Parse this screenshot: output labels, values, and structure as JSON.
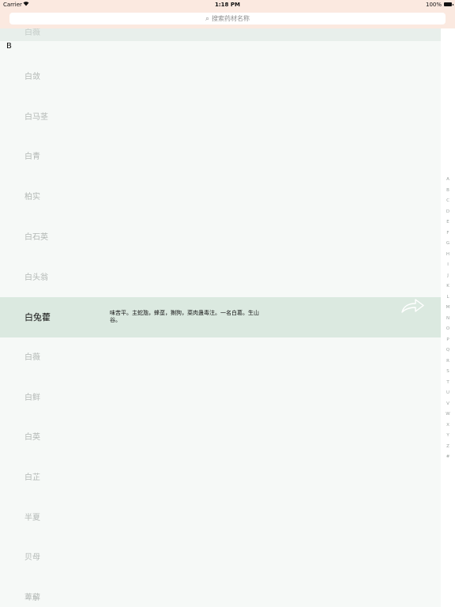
{
  "status_bar": {
    "carrier": "Carrier",
    "time": "1:18 PM",
    "battery": "100%"
  },
  "search": {
    "placeholder": "搜索药材名称"
  },
  "list": {
    "partial_top_item": "白薇",
    "section_header": "B",
    "items": [
      {
        "name": "白敛"
      },
      {
        "name": "白马茎"
      },
      {
        "name": "白青"
      },
      {
        "name": "柏实"
      },
      {
        "name": "白石英"
      },
      {
        "name": "白头翁"
      },
      {
        "name": "白兔藿",
        "selected": true,
        "description": "味苦平。主蛇虺，蜂虿，猘狗，菜肉蛊毒注。一名白葛。生山谷。"
      },
      {
        "name": "白薇"
      },
      {
        "name": "白鲜"
      },
      {
        "name": "白英"
      },
      {
        "name": "白芷"
      },
      {
        "name": "半夏"
      },
      {
        "name": "贝母"
      },
      {
        "name": "萆薢"
      }
    ]
  },
  "index_bar": [
    "A",
    "B",
    "C",
    "D",
    "E",
    "F",
    "G",
    "H",
    "I",
    "J",
    "K",
    "L",
    "M",
    "N",
    "O",
    "P",
    "Q",
    "R",
    "S",
    "T",
    "U",
    "V",
    "W",
    "X",
    "Y",
    "Z",
    "#"
  ],
  "colors": {
    "header_bg": "#fbe9e0",
    "list_bg": "#f6f9f7",
    "selected_bg": "#dbe9e0",
    "muted_text": "#b3b8b5"
  }
}
